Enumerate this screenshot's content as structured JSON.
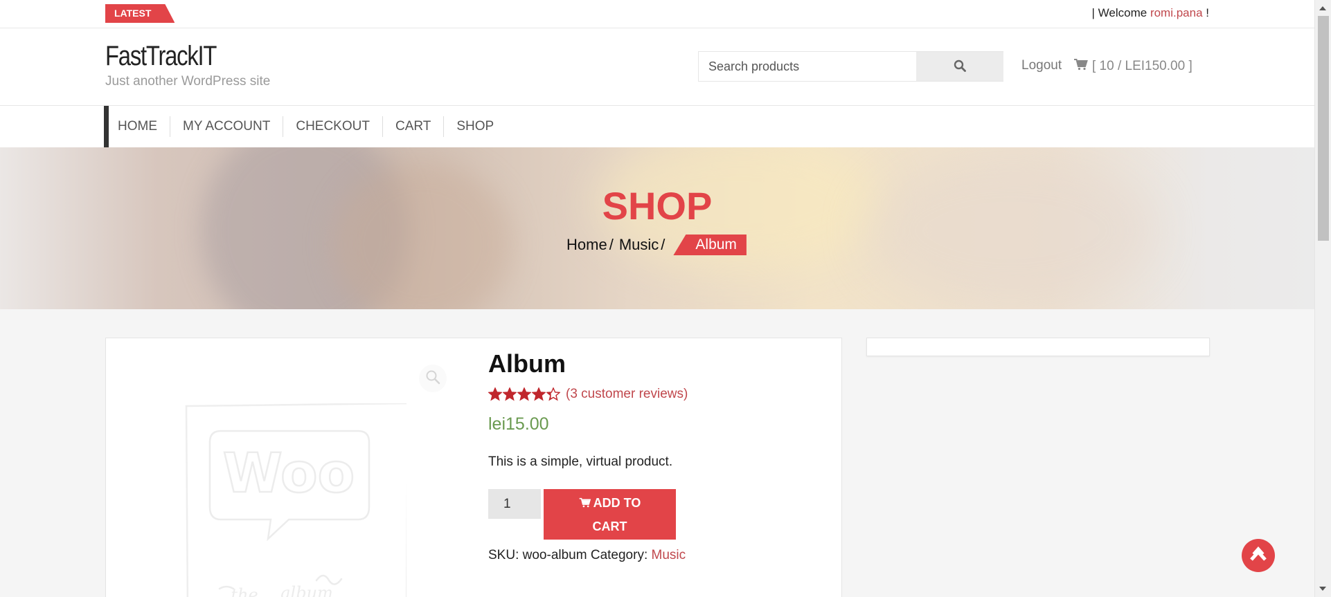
{
  "topbar": {
    "latest_label": "LATEST",
    "welcome_prefix": "| Welcome ",
    "username": "romi.pana",
    "welcome_suffix": " !"
  },
  "header": {
    "site_title": "FastTrackIT",
    "tagline": "Just another WordPress site",
    "search_placeholder": "Search products",
    "search_icon": "search-icon",
    "logout_label": "Logout",
    "cart_icon": "cart-icon",
    "cart_summary": "[ 10 / LEI150.00 ]"
  },
  "nav": {
    "items": [
      {
        "label": "HOME"
      },
      {
        "label": "MY ACCOUNT"
      },
      {
        "label": "CHECKOUT"
      },
      {
        "label": "CART"
      },
      {
        "label": "SHOP"
      }
    ]
  },
  "hero": {
    "title": "SHOP",
    "breadcrumb": {
      "home": "Home",
      "sep": "/",
      "category": "Music",
      "current": "Album"
    }
  },
  "product": {
    "title": "Album",
    "rating": 4.33,
    "rating_max": 5,
    "reviews_label": "(3 customer reviews)",
    "price": "lei15.00",
    "description": "This is a simple, virtual product.",
    "quantity": "1",
    "add_to_cart_line1": "ADD TO",
    "add_to_cart_line2": "CART",
    "sku_label": "SKU:",
    "sku": "woo-album",
    "category_label": "Category:",
    "category": "Music",
    "image_text": "Woo",
    "image_caption_1": "the",
    "image_caption_2": "album"
  },
  "colors": {
    "accent": "#e24448",
    "link": "#c0474c",
    "price": "#6a9a50"
  }
}
